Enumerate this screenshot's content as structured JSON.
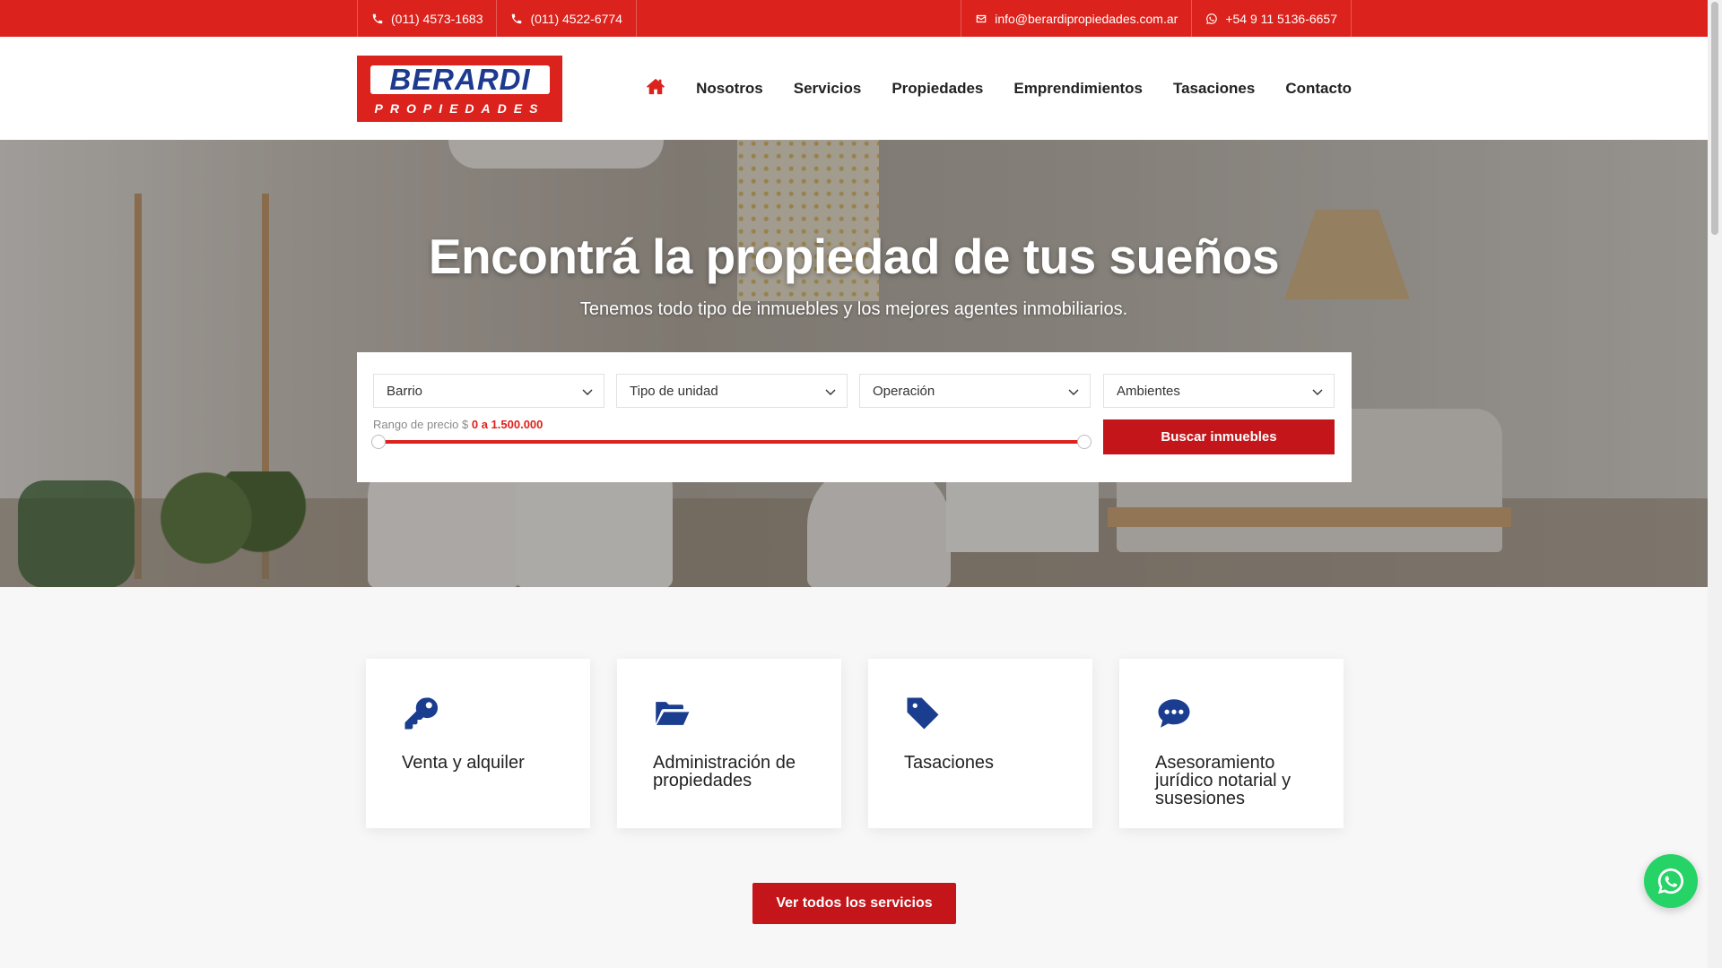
{
  "topbar": {
    "phone1": "(011) 4573-1683",
    "phone2": "(011) 4522-6774",
    "email": "info@berardipropiedades.com.ar",
    "whatsapp": "+54 9 11 5136-6657"
  },
  "logo": {
    "brand": "BERARDI",
    "sub": "PROPIEDADES"
  },
  "nav": {
    "items": [
      "Nosotros",
      "Servicios",
      "Propiedades",
      "Emprendimientos",
      "Tasaciones",
      "Contacto"
    ]
  },
  "hero": {
    "title": "Encontrá la propiedad de tus sueños",
    "subtitle": "Tenemos todo tipo de inmuebles y los mejores agentes inmobiliarios."
  },
  "search": {
    "barrio": "Barrio",
    "tipo": "Tipo de unidad",
    "operacion": "Operación",
    "ambientes": "Ambientes",
    "range_label": "Rango de precio $",
    "range_value": "0 a 1.500.000",
    "button": "Buscar inmuebles"
  },
  "services": [
    {
      "icon": "key-icon",
      "title": "Venta y alquiler"
    },
    {
      "icon": "folder-open-icon",
      "title": "Administración de propiedades"
    },
    {
      "icon": "tag-icon",
      "title": "Tasaciones"
    },
    {
      "icon": "chat-bubble-icon",
      "title": "Asesoramiento jurídico notarial y susesiones"
    }
  ],
  "services_button": "Ver todos los servicios",
  "colors": {
    "primary": "#dc221c",
    "button": "#c4151a",
    "icon_blue": "#1a3d8f",
    "whatsapp": "#25d366"
  }
}
